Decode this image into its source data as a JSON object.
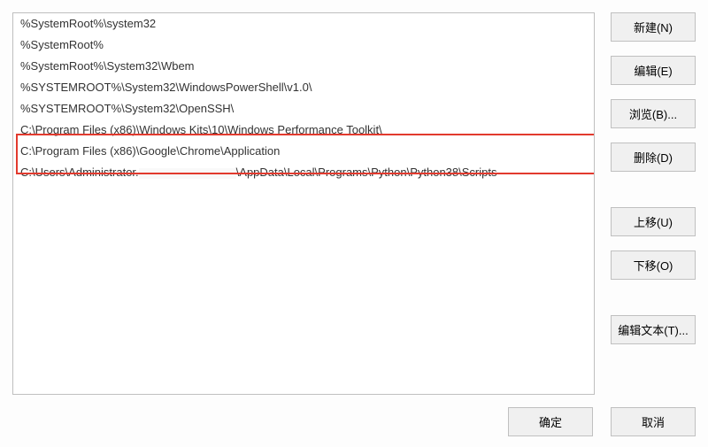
{
  "list": {
    "items": [
      "%SystemRoot%\\system32",
      "%SystemRoot%",
      "%SystemRoot%\\System32\\Wbem",
      "%SYSTEMROOT%\\System32\\WindowsPowerShell\\v1.0\\",
      "%SYSTEMROOT%\\System32\\OpenSSH\\",
      "C:\\Program Files (x86)\\Windows Kits\\10\\Windows Performance Toolkit\\",
      "C:\\Program Files (x86)\\Google\\Chrome\\Application"
    ],
    "redacted_item_prefix": "C:\\Users\\Administrator.",
    "redacted_item_suffix": "\\AppData\\Local\\Programs\\Python\\Python38\\Scripts"
  },
  "buttons": {
    "new": "新建(N)",
    "edit": "编辑(E)",
    "browse": "浏览(B)...",
    "delete": "删除(D)",
    "move_up": "上移(U)",
    "move_down": "下移(O)",
    "edit_text": "编辑文本(T)...",
    "ok": "确定",
    "cancel": "取消"
  }
}
